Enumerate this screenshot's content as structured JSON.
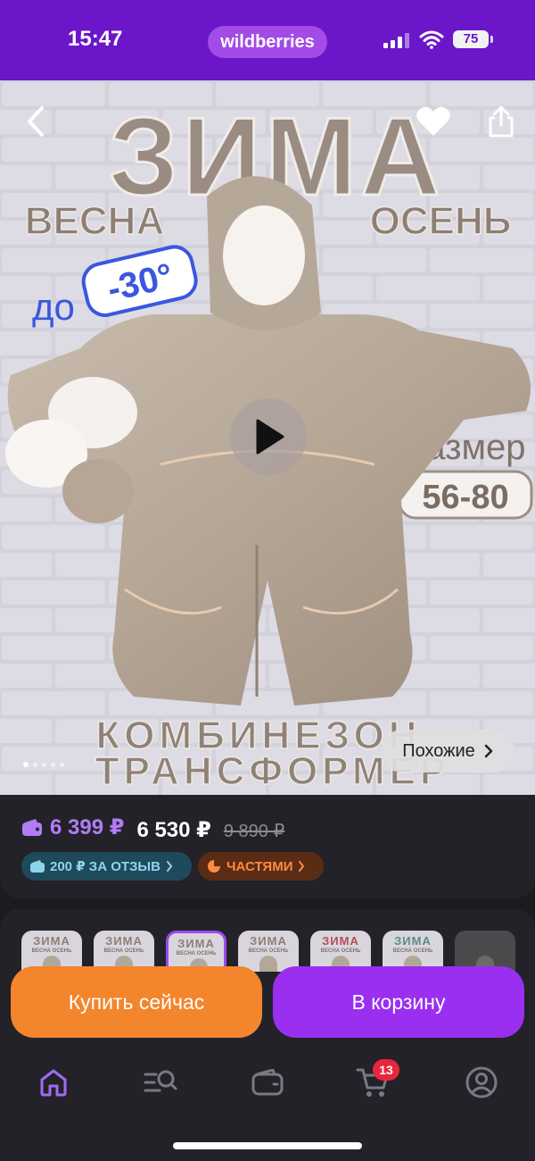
{
  "status_bar": {
    "time": "15:47",
    "brand": "wildberries",
    "battery": "75",
    "icons": [
      "signal-icon",
      "wifi-icon",
      "battery-icon"
    ]
  },
  "product_gallery": {
    "banner": {
      "headline": "ЗИМА",
      "left_season": "ВЕСНА",
      "right_season": "ОСЕНЬ",
      "temp_prefix": "до",
      "temp_value": "-30°",
      "size_label": "Размер",
      "size_range": "56-80",
      "bottom_line1": "КОМБИНЕЗОН",
      "bottom_line2": "ТРАНСФОРМЕР"
    },
    "similar_label": "Похожие",
    "slides_total": 5,
    "slide_active": 1,
    "icons": [
      "back-icon",
      "heart-icon",
      "share-icon",
      "play-icon",
      "chevron-right-icon"
    ]
  },
  "price": {
    "wallet_price": "6 399 ₽",
    "price": "6 530 ₽",
    "old_price": "9 890 ₽",
    "review_bonus": "200 ₽ ЗА ОТЗЫВ",
    "installments": "ЧАСТЯМИ"
  },
  "thumbnails": [
    {
      "word": "ЗИМА",
      "sub": "ВЕСНА   ОСЕНЬ",
      "color": "#8c7f76"
    },
    {
      "word": "ЗИМА",
      "sub": "ВЕСНА   ОСЕНЬ",
      "color": "#8c7f76"
    },
    {
      "word": "ЗИМА",
      "sub": "ВЕСНА   ОСЕНЬ",
      "color": "#8c7f76"
    },
    {
      "word": "ЗИМА",
      "sub": "ВЕСНА   ОСЕНЬ",
      "color": "#8c7f76"
    },
    {
      "word": "ЗИМА",
      "sub": "ВЕСНА   ОСЕНЬ",
      "color": "#b84a5a"
    },
    {
      "word": "ЗИМА",
      "sub": "ВЕСНА   ОСЕНЬ",
      "color": "#5c8a86"
    },
    {
      "word": "",
      "sub": "",
      "color": "#5a5a5a"
    }
  ],
  "actions": {
    "buy_now": "Купить сейчас",
    "add_to_cart": "В корзину"
  },
  "tab_bar": {
    "tabs": [
      "home",
      "catalog-search",
      "wallet",
      "cart",
      "profile"
    ],
    "cart_badge": "13"
  },
  "colors": {
    "brand": "#6b16c9",
    "buy_button": "#f3852c",
    "cart_button": "#9b2ff0",
    "wallet_price": "#b27cf6",
    "badge_red": "#e8263d"
  }
}
